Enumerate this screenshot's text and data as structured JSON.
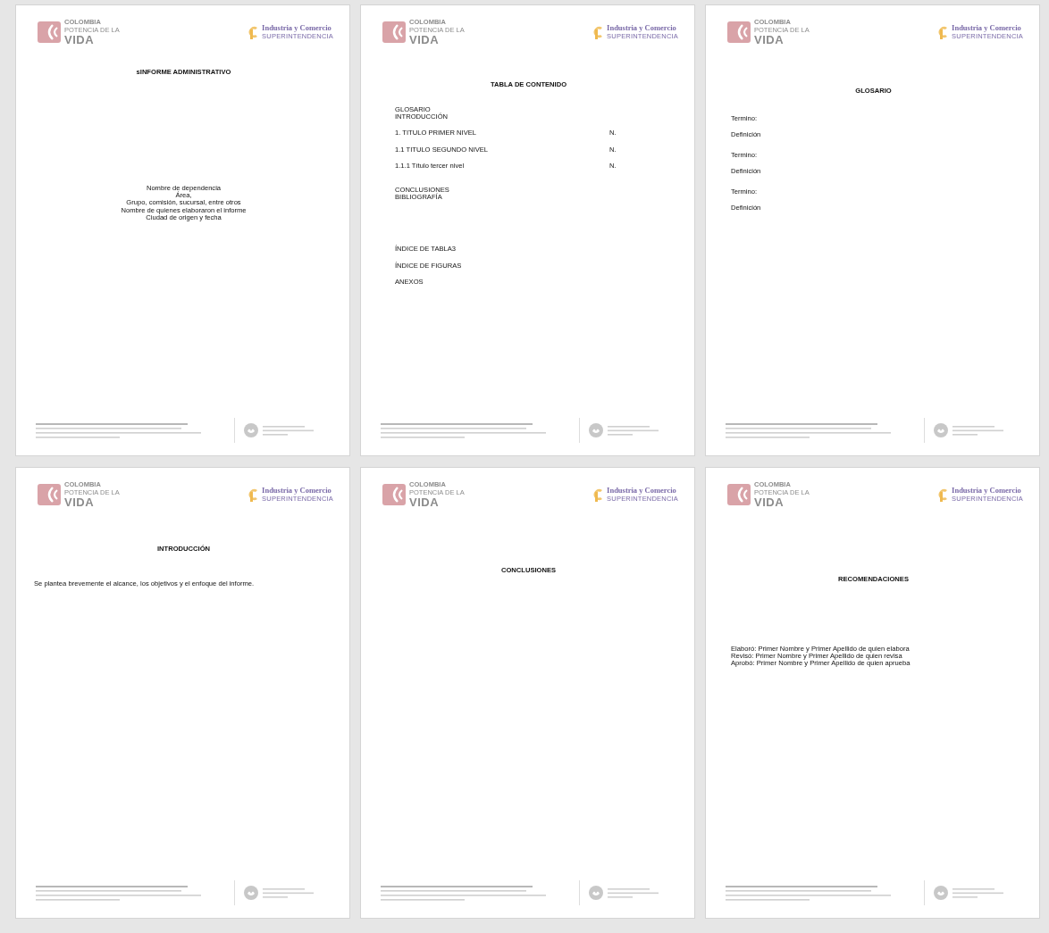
{
  "pages": [
    {
      "header": {
        "left_logo": [
          "COLOMBIA",
          "POTENCIA DE LA",
          "VIDA"
        ],
        "right_logo": [
          "Industria y Comercio",
          "SUPERINTENDENCIA"
        ]
      },
      "kind": "cover",
      "title": "sINFORME ADMINISTRATIVO",
      "lines": [
        "Nombre de dependencia",
        "Área,",
        "Grupo, comisión, sucursal, entre otros",
        "Nombre de quienes elaboraron el informe",
        "Ciudad de origen y fecha"
      ]
    },
    {
      "header": {
        "left_logo": [
          "COLOMBIA",
          "POTENCIA DE LA",
          "VIDA"
        ],
        "right_logo": [
          "Industria y Comercio",
          "SUPERINTENDENCIA"
        ]
      },
      "kind": "toc",
      "title": "TABLA DE CONTENIDO",
      "groups": [
        [
          {
            "text": "GLOSARIO"
          },
          {
            "text": "INTRODUCCIÓN"
          }
        ],
        [
          {
            "text": "1.  TITULO PRIMER NIVEL",
            "page": "N."
          }
        ],
        [
          {
            "text": "1.1 TITULO SEGUNDO NIVEL",
            "page": "N."
          }
        ],
        [
          {
            "text": "1.1.1  Título tercer nivel",
            "page": "N."
          }
        ],
        [
          {
            "text": "CONCLUSIONES"
          },
          {
            "text": "BIBLIOGRAFÍA"
          }
        ],
        [
          {
            "text": "ÍNDICE DE TABLA3"
          }
        ],
        [
          {
            "text": "ÍNDICE DE FIGURAS"
          }
        ],
        [
          {
            "text": "ANEXOS"
          }
        ]
      ]
    },
    {
      "header": {
        "left_logo": [
          "COLOMBIA",
          "POTENCIA DE LA",
          "VIDA"
        ],
        "right_logo": [
          "Industria y Comercio",
          "SUPERINTENDENCIA"
        ]
      },
      "kind": "glossary",
      "title": "GLOSARIO",
      "items": [
        {
          "term": "Termino:",
          "definition": "Definición"
        },
        {
          "term": "Termino:",
          "definition": "Definición"
        },
        {
          "term": "Termino:",
          "definition": "Definición"
        }
      ]
    },
    {
      "header": {
        "left_logo": [
          "COLOMBIA",
          "POTENCIA DE LA",
          "VIDA"
        ],
        "right_logo": [
          "Industria y Comercio",
          "SUPERINTENDENCIA"
        ]
      },
      "kind": "section",
      "title": "INTRODUCCIÓN",
      "text": "Se plantea brevemente el alcance, los objetivos y el enfoque del informe."
    },
    {
      "header": {
        "left_logo": [
          "COLOMBIA",
          "POTENCIA DE LA",
          "VIDA"
        ],
        "right_logo": [
          "Industria y Comercio",
          "SUPERINTENDENCIA"
        ]
      },
      "kind": "section",
      "title": "CONCLUSIONES"
    },
    {
      "header": {
        "left_logo": [
          "COLOMBIA",
          "POTENCIA DE LA",
          "VIDA"
        ],
        "right_logo": [
          "Industria y Comercio",
          "SUPERINTENDENCIA"
        ]
      },
      "kind": "signatures",
      "title": "RECOMENDACIONES",
      "lines": [
        "Elaboró: Primer Nombre  y  Primer Apellido de quien elabora",
        "Revisó: Primer Nombre  y  Primer Apellido de quien revisa",
        "Aprobó: Primer Nombre  y  Primer Apellido de quien aprueba"
      ]
    }
  ]
}
